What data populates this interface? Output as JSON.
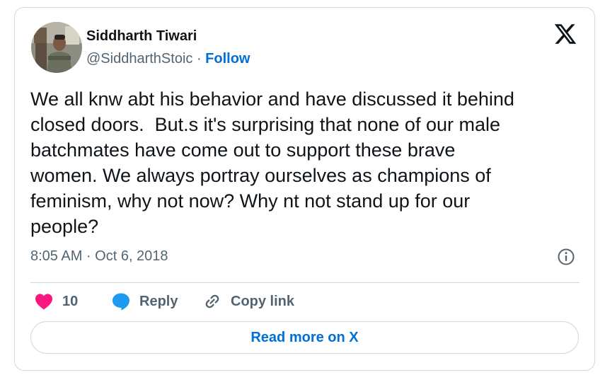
{
  "author": {
    "display_name": "Siddharth Tiwari",
    "handle": "@SiddharthStoic",
    "separator": " · ",
    "follow_label": "Follow",
    "avatar_icon": "profile-photo"
  },
  "brand": {
    "logo_icon": "x-logo-icon"
  },
  "tweet": {
    "text": "We all knw abt his behavior and have discussed it behind\nclosed doors.  But.s it's surprising that none of our male\nbatchmates have come out to support these brave\nwomen. We always portray ourselves as champions of\nfeminism, why not now? Why nt not stand up for our\npeople?",
    "timestamp": "8:05 AM · Oct 6, 2018"
  },
  "actions": {
    "like_count": "10",
    "reply_label": "Reply",
    "copy_link_label": "Copy link",
    "read_more_label": "Read more on X"
  },
  "colors": {
    "text": "#0f1419",
    "secondary_text": "#536471",
    "link_blue": "#006fd6",
    "reply_icon_blue": "#1d9bf0",
    "heart_red": "#f91880",
    "border": "#cfd9de"
  }
}
